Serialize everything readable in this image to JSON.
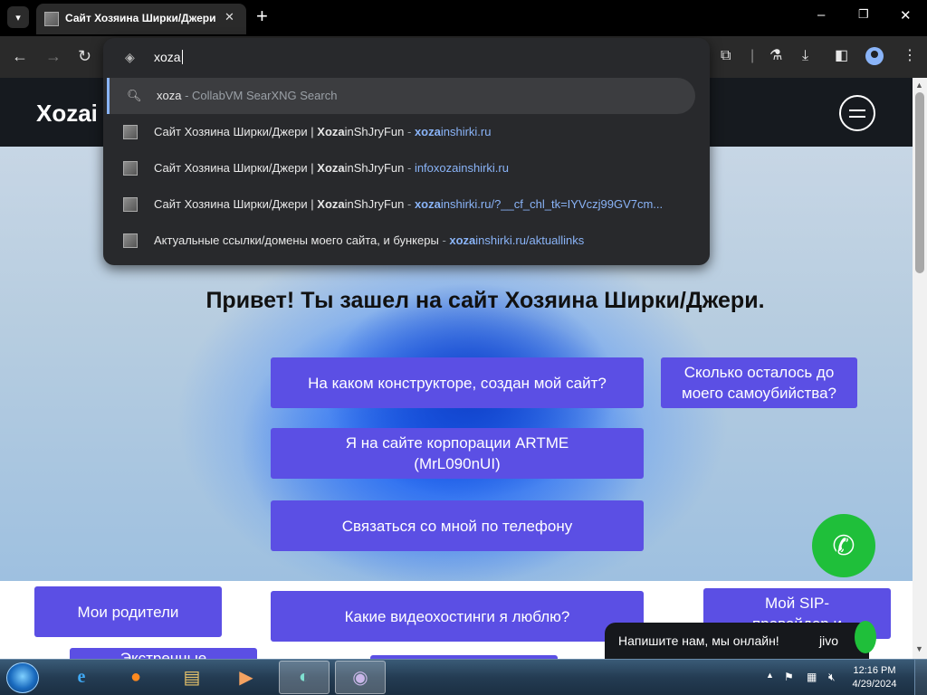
{
  "browser": {
    "tab_title": "Сайт Хозяина Ширки/Джери",
    "tab_close": "✕",
    "new_tab": "+",
    "window_buttons": {
      "minimize": "–",
      "restore": "❐",
      "close": "✕"
    },
    "address_text": "xoza"
  },
  "omnibox": {
    "suggestions": [
      {
        "kind": "search",
        "text": "xoza",
        "sep": " - ",
        "detail": "CollabVM SearXNG Search",
        "selected": true
      },
      {
        "kind": "history",
        "pre": "Сайт Хозяина Ширки/Джери | ",
        "bold": "Xoza",
        "post": "inShJryFun",
        "sep": " - ",
        "url_bold": "xoza",
        "url_rest": "inshirki.ru"
      },
      {
        "kind": "history",
        "pre": "Сайт Хозяина Ширки/Джери | ",
        "bold": "Xoza",
        "post": "inShJryFun",
        "sep": " - ",
        "url_bold": "",
        "url_rest": "infoxozainshirki.ru"
      },
      {
        "kind": "history",
        "pre": "Сайт Хозяина Ширки/Джери | ",
        "bold": "Xoza",
        "post": "inShJryFun",
        "sep": " - ",
        "url_bold": "xoza",
        "url_rest": "inshirki.ru/?__cf_chl_tk=IYVczj99GV7cm..."
      },
      {
        "kind": "history",
        "pre": "Актуальные ссылки/домены моего сайта, и бункеры",
        "bold": "",
        "post": "",
        "sep": " - ",
        "url_bold": "xoza",
        "url_rest": "inshirki.ru/aktuallinks"
      }
    ]
  },
  "site": {
    "logo": "Xozai",
    "heading": "Привет! Ты зашел на сайт Хозяина Ширки/Джери.",
    "buttons": {
      "constructor": "На каком конструкторе, создан мой сайт?",
      "suicide": "Сколько осталось до моего самоубийства?",
      "artme": "Я на сайте корпорации ARTME (MrL090nUI)",
      "phone": "Связаться со мной по телефону",
      "parents": "Мои родители",
      "videohosting": "Какие видеохостинги я люблю?",
      "sip": "Мой SIP-провайдер и",
      "emergency": "Экстренные"
    },
    "jivo_text": "Напишите нам, мы онлайн!",
    "jivo_logo": "jivo"
  },
  "taskbar": {
    "clock_time": "12:16 PM",
    "clock_date": "4/29/2024"
  }
}
